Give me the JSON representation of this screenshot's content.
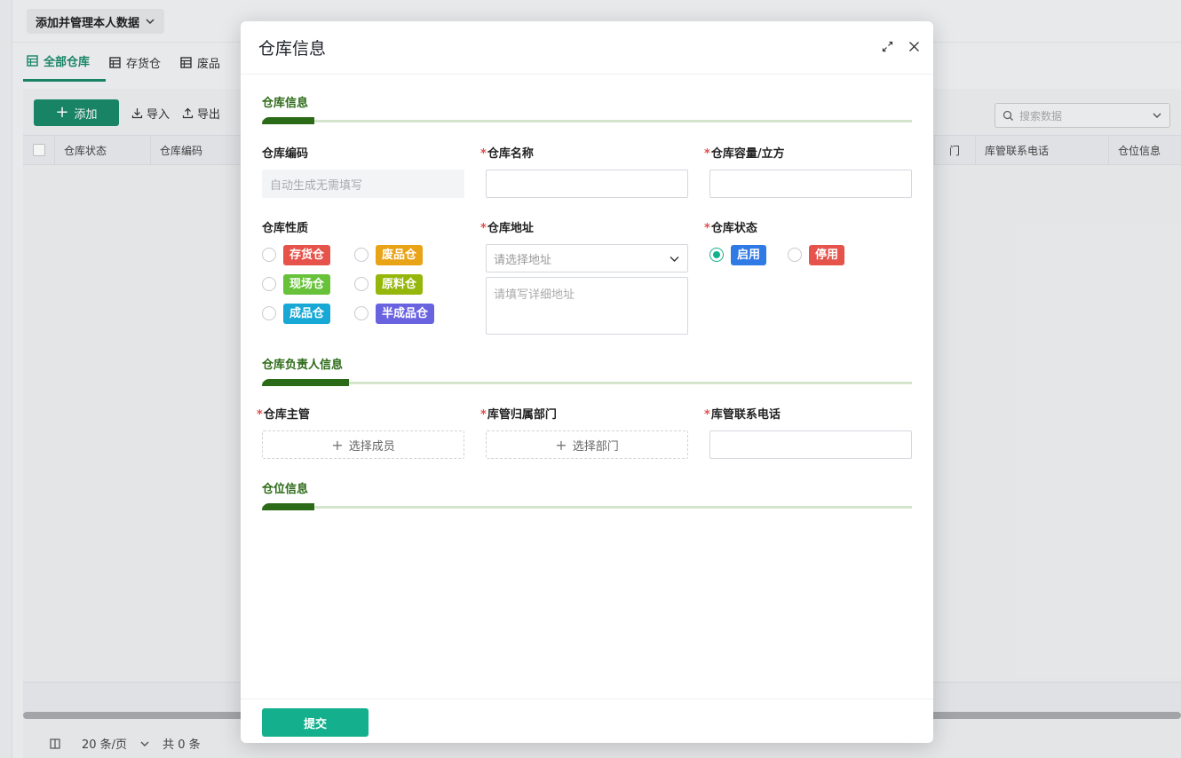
{
  "background": {
    "view_switch": "添加并管理本人数据",
    "tabs": [
      {
        "label": "全部仓库"
      },
      {
        "label": "存货仓"
      },
      {
        "label": "废品"
      }
    ],
    "toolbar": {
      "add": "添加",
      "import": "导入",
      "export": "导出"
    },
    "search_placeholder": "搜索数据",
    "columns_left": [
      "仓库状态",
      "仓库编码"
    ],
    "columns_right": [
      "门",
      "库管联系电话",
      "仓位信息"
    ],
    "pager": {
      "page_size": "20 条/页",
      "total": "共 0 条"
    }
  },
  "modal": {
    "title": "仓库信息",
    "sections": {
      "basic": "仓库信息",
      "manager": "仓库负责人信息",
      "location": "仓位信息"
    },
    "fields": {
      "code": {
        "label": "仓库编码",
        "placeholder": "自动生成无需填写"
      },
      "name": {
        "label": "仓库名称",
        "required_mark": "*",
        "value": ""
      },
      "capacity": {
        "label": "仓库容量/立方",
        "required_mark": "*",
        "value": ""
      },
      "nature": {
        "label": "仓库性质",
        "options": [
          {
            "label": "存货仓",
            "color": "#e5534b"
          },
          {
            "label": "废品仓",
            "color": "#e8a317"
          },
          {
            "label": "现场仓",
            "color": "#67c23a"
          },
          {
            "label": "原料仓",
            "color": "#95b70b"
          },
          {
            "label": "成品仓",
            "color": "#17a8d6"
          },
          {
            "label": "半成品仓",
            "color": "#6a63e0"
          }
        ]
      },
      "address": {
        "label": "仓库地址",
        "required_mark": "*",
        "select_placeholder": "请选择地址",
        "detail_placeholder": "请填写详细地址"
      },
      "status": {
        "label": "仓库状态",
        "required_mark": "*",
        "options": [
          {
            "label": "启用",
            "color": "#2f7ae5",
            "checked": true
          },
          {
            "label": "停用",
            "color": "#e5534b",
            "checked": false
          }
        ]
      },
      "supervisor": {
        "label": "仓库主管",
        "required_mark": "*",
        "button": "选择成员"
      },
      "department": {
        "label": "库管归属部门",
        "required_mark": "*",
        "button": "选择部门"
      },
      "phone": {
        "label": "库管联系电话",
        "required_mark": "*",
        "value": ""
      }
    },
    "submit": "提交"
  }
}
